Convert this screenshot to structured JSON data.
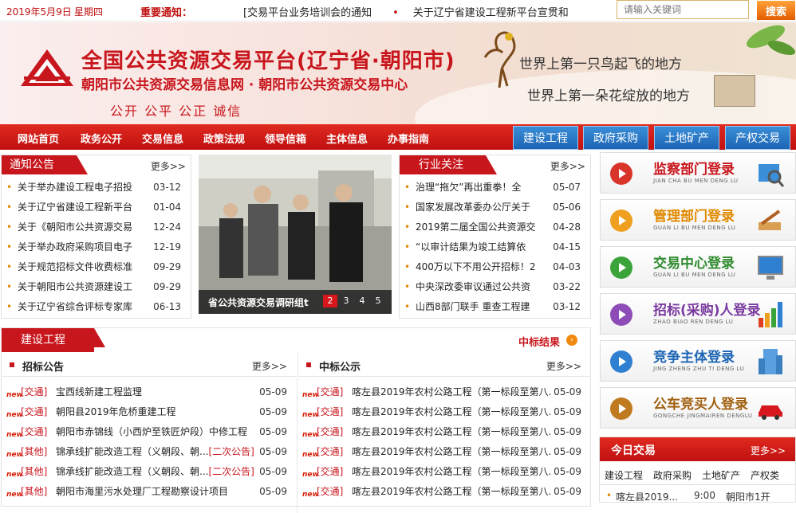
{
  "topbar": {
    "date": "2019年5月9日",
    "weekday": "星期四",
    "notice_label": "重要通知：",
    "ticker": [
      "[交易平台业务培训会的通知",
      "关于辽宁省建设工程新平台宣贯和"
    ],
    "search_placeholder": "请输入关键词",
    "search_button": "搜索"
  },
  "banner": {
    "title": "全国公共资源交易平台(辽宁省·朝阳市)",
    "subtitle": "朝阳市公共资源交易信息网 · 朝阳市公共资源交易中心",
    "motto": "公开  公平  公正  诚信",
    "slogan1": "世界上第一只鸟起飞的地方",
    "slogan2": "世界上第一朵花绽放的地方"
  },
  "nav": {
    "items": [
      "网站首页",
      "政务公开",
      "交易信息",
      "政策法规",
      "领导信箱",
      "主体信息",
      "办事指南"
    ],
    "tabs": [
      "建设工程",
      "政府采购",
      "土地矿产",
      "产权交易"
    ]
  },
  "notices": {
    "title": "通知公告",
    "more": "更多>>",
    "items": [
      {
        "title": "关于举办建设工程电子招投",
        "date": "03-12"
      },
      {
        "title": "关于辽宁省建设工程新平台",
        "date": "01-04"
      },
      {
        "title": "关于《朝阳市公共资源交易",
        "date": "12-24"
      },
      {
        "title": "关于举办政府采购项目电子",
        "date": "12-19"
      },
      {
        "title": "关于规范招标文件收费标准",
        "date": "09-29"
      },
      {
        "title": "关于朝阳市公共资源建设工",
        "date": "09-29"
      },
      {
        "title": "关于辽宁省综合评标专家库",
        "date": "06-13"
      }
    ]
  },
  "photo": {
    "caption": "省公共资源交易调研组t",
    "pages": [
      "2",
      "3",
      "4",
      "5"
    ]
  },
  "industry": {
    "title": "行业关注",
    "more": "更多>>",
    "items": [
      {
        "title": "治理“拖欠”再出重拳！全",
        "date": "05-07"
      },
      {
        "title": "国家发展改革委办公厅关于",
        "date": "05-06"
      },
      {
        "title": "2019第二届全国公共资源交",
        "date": "04-28"
      },
      {
        "title": "“以审计结果为竣工结算依",
        "date": "04-15"
      },
      {
        "title": "400万以下不用公开招标！2",
        "date": "04-03"
      },
      {
        "title": "中央深改委审议通过公共资",
        "date": "03-22"
      },
      {
        "title": "山西8部门联手 重查工程建",
        "date": "03-12"
      }
    ]
  },
  "construction": {
    "title": "建设工程",
    "result_link": "中标结果",
    "bidding": {
      "label": "招标公告",
      "more": "更多>>",
      "items": [
        {
          "cat": "[交通]",
          "title": "宝西线新建工程监理",
          "suffix": "",
          "date": "05-09"
        },
        {
          "cat": "[交通]",
          "title": "朝阳县2019年危桥重建工程",
          "suffix": "",
          "date": "05-09"
        },
        {
          "cat": "[交通]",
          "title": "朝阳市赤锦线（小西炉至铁匠炉段）中修工程",
          "suffix": "",
          "date": "05-09"
        },
        {
          "cat": "[其他]",
          "title": "锦承线扩能改造工程（义朝段、朝...",
          "suffix": "[二次公告]",
          "date": "05-09"
        },
        {
          "cat": "[其他]",
          "title": "锦承线扩能改造工程（义朝段、朝...",
          "suffix": "[二次公告]",
          "date": "05-09"
        },
        {
          "cat": "[其他]",
          "title": "朝阳市海里污水处理厂工程勘察设计项目",
          "suffix": "",
          "date": "05-09"
        }
      ]
    },
    "award": {
      "label": "中标公示",
      "more": "更多>>",
      "items": [
        {
          "cat": "[交通]",
          "title": "喀左县2019年农村公路工程（第一标段至第八...",
          "date": "05-09"
        },
        {
          "cat": "[交通]",
          "title": "喀左县2019年农村公路工程（第一标段至第八...",
          "date": "05-09"
        },
        {
          "cat": "[交通]",
          "title": "喀左县2019年农村公路工程（第一标段至第八...",
          "date": "05-09"
        },
        {
          "cat": "[交通]",
          "title": "喀左县2019年农村公路工程（第一标段至第八...",
          "date": "05-09"
        },
        {
          "cat": "[交通]",
          "title": "喀左县2019年农村公路工程（第一标段至第八...",
          "date": "05-09"
        },
        {
          "cat": "[交通]",
          "title": "喀左县2019年农村公路工程（第一标段至第八...",
          "date": "05-09"
        }
      ]
    }
  },
  "logins": [
    {
      "title": "监察部门登录",
      "sub": "JIAN CHA BU MEN DENG LU",
      "color": "#c8161d",
      "circle": "#d9342a",
      "icon": "magnifier-icon"
    },
    {
      "title": "管理部门登录",
      "sub": "GUAN LI BU MEN DENG LU",
      "color": "#e08a00",
      "circle": "#f0a020",
      "icon": "pen-icon"
    },
    {
      "title": "交易中心登录",
      "sub": "GUAN LI BU MEN DENG LU",
      "color": "#2e8b2e",
      "circle": "#3aa33a",
      "icon": "monitor-icon"
    },
    {
      "title": "招标(采购)人登录",
      "sub": "ZHAO BIAO REN DENG LU",
      "color": "#7a3aa0",
      "circle": "#8e4cb8",
      "icon": "bar-chart-icon"
    },
    {
      "title": "竞争主体登录",
      "sub": "JING ZHENG ZHU TI DENG LU",
      "color": "#1c64b4",
      "circle": "#2f80d0",
      "icon": "building-icon"
    },
    {
      "title": "公车竞买人登录",
      "sub": "GONGCHE JINGMAIREN DENGLU",
      "color": "#a06010",
      "circle": "#c07a20",
      "icon": "car-icon"
    }
  ],
  "today": {
    "title": "今日交易",
    "more": "更多>>",
    "tabs": [
      "建设工程",
      "政府采购",
      "土地矿产",
      "产权类"
    ],
    "row": {
      "name": "喀左县2019...",
      "time": "9:00",
      "place": "朝阳市1开"
    }
  }
}
